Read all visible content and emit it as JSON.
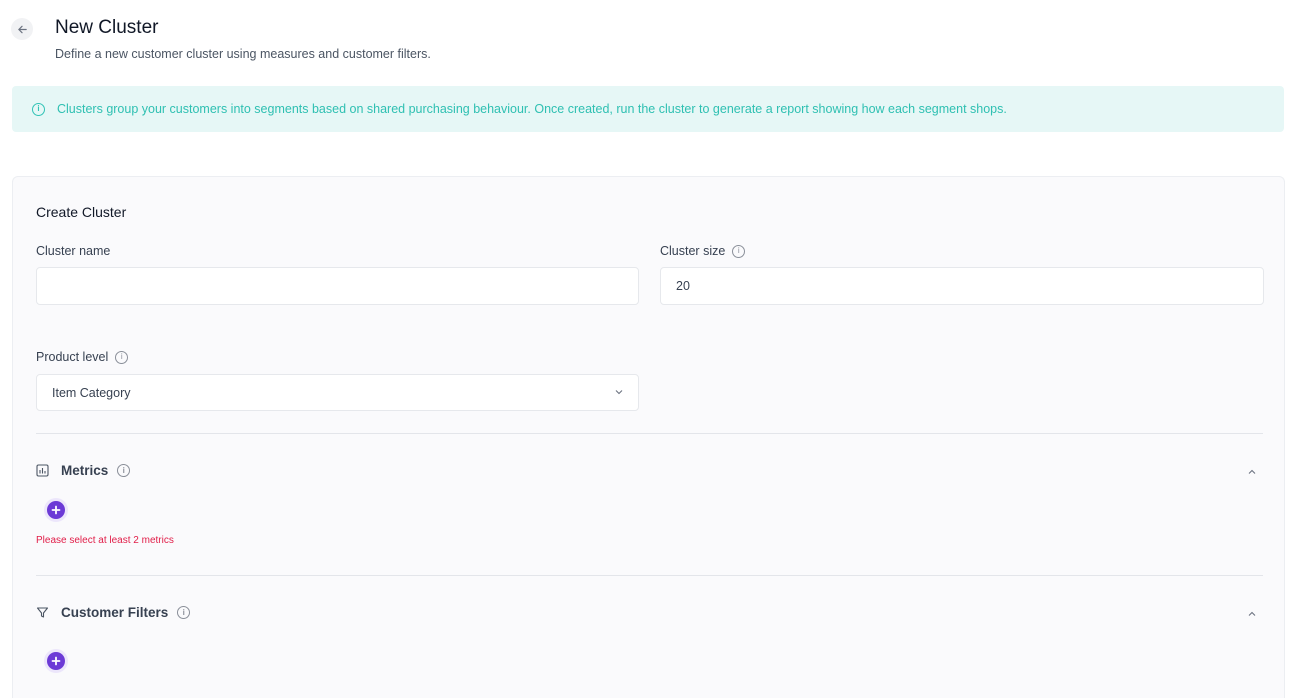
{
  "header": {
    "back_icon": "arrow-left-icon",
    "title": "New Cluster",
    "subtitle": "Define a new customer cluster using measures and customer filters."
  },
  "banner": {
    "icon": "info-icon",
    "text": "Clusters group your customers into segments based on shared purchasing behaviour. Once created, run the cluster to generate a report showing how each segment shops.",
    "color": "#2fc0b2",
    "background": "#e6f7f6"
  },
  "form": {
    "title": "Create Cluster",
    "cluster_name": {
      "label": "Cluster name",
      "value": "",
      "placeholder": ""
    },
    "cluster_size": {
      "label": "Cluster size",
      "value": "20"
    },
    "product_level": {
      "label": "Product level",
      "selected": "Item Category"
    }
  },
  "metrics": {
    "label": "Metrics",
    "icon": "bar-chart-icon",
    "error": "Please select at least 2 metrics"
  },
  "customer_filters": {
    "label": "Customer Filters",
    "icon": "filter-icon"
  },
  "colors": {
    "accent": "#6c3ad6",
    "error": "#e11d48"
  }
}
